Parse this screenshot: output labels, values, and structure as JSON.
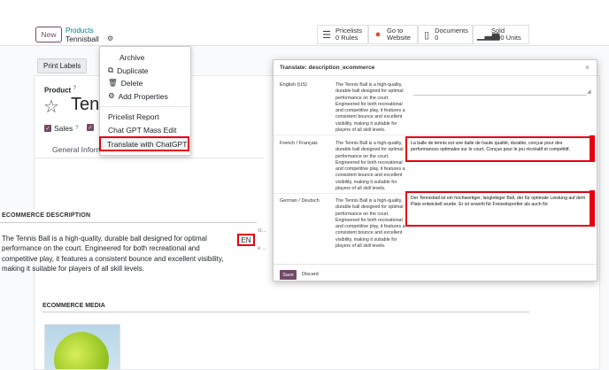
{
  "header": {
    "new_label": "New",
    "breadcrumb_parent": "Products",
    "breadcrumb_current": "Tennisball",
    "smart_buttons": [
      {
        "title": "Pricelists",
        "sub": "0 Rules"
      },
      {
        "title": "Go to",
        "sub": "Website"
      },
      {
        "title": "Documents",
        "sub": "0"
      },
      {
        "title": "Sold",
        "sub": "0.00 Units"
      }
    ]
  },
  "form": {
    "print_labels": "Print Labels",
    "product_label": "Product",
    "product_help": "?",
    "product_name": "Tenn",
    "sales_label": "Sales",
    "sales_help": "?",
    "tab_general": "General Inform"
  },
  "menu": {
    "items": [
      {
        "label": "Archive",
        "icon": ""
      },
      {
        "label": "Duplicate",
        "icon": "copy-icon"
      },
      {
        "label": "Delete",
        "icon": "trash-icon"
      },
      {
        "label": "Add Properties",
        "icon": "cogs-icon"
      },
      {
        "label": "Pricelist Report",
        "icon": ""
      },
      {
        "label": "Chat GPT Mass Edit",
        "icon": ""
      },
      {
        "label": "Translate with ChatGPT",
        "icon": ""
      }
    ]
  },
  "ecommerce": {
    "title": "ECOMMERCE DESCRIPTION",
    "text": "The Tennis Ball is a high-quality, durable ball designed for optimal performance on the court. Engineered for both recreational and competitive play, it features a consistent bounce and excellent visibility, making it suitable for players of all skill levels.",
    "lang_badge": "EN",
    "ellipsis_1": "st...",
    "ellipsis_2": "e ...",
    "media_title": "ECOMMERCE MEDIA"
  },
  "dialog": {
    "title": "Translate: description_ecommerce",
    "rows": [
      {
        "lang": "English (US)",
        "source": "The Tennis Ball is a high-quality, durable ball designed for optimal performance on the court. Engineered for both recreational and competitive play, it features a consistent bounce and excellent visibility, making it suitable for players of all skill levels.",
        "target": ""
      },
      {
        "lang": "French / Français",
        "source": "The Tennis Ball is a high-quality, durable ball designed for optimal performance on the court. Engineered for both recreational and competitive play, it features a consistent bounce and excellent visibility, making it suitable for players of all skill levels.",
        "target": "La balle de tennis est une balle de haute qualité, durable, conçue pour des performances optimales sur le court. Conçue pour le jeu récréatif et compétitif,"
      },
      {
        "lang": "German / Deutsch",
        "source": "The Tennis Ball is a high-quality, durable ball designed for optimal performance on the court. Engineered for both recreational and competitive play, it features a consistent bounce and excellent visibility, making it suitable for players of all skill levels.",
        "target": "Der Tennisball ist ein hochwertiger, langlebiger Ball, der für optimale Leistung auf dem Platz entwickelt wurde. Er ist sowohl für Freizeitsportler als auch für"
      }
    ],
    "save_label": "Save",
    "discard_label": "Discard"
  },
  "colors": {
    "brand": "#714b67",
    "highlight": "#e60012",
    "link": "#017e84"
  }
}
